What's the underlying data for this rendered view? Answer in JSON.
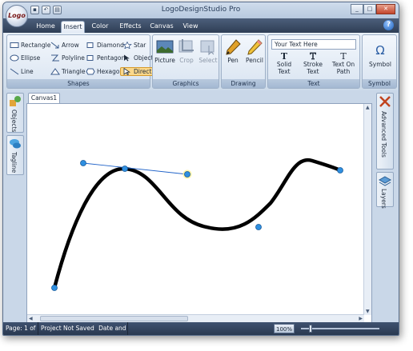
{
  "window": {
    "title": "LogoDesignStudio Pro",
    "logo_text": "Logo"
  },
  "quick_access": [
    "save-icon",
    "undo-icon",
    "print-icon"
  ],
  "tabs": [
    {
      "label": "Home",
      "active": false
    },
    {
      "label": "Insert",
      "active": true
    },
    {
      "label": "Color",
      "active": false
    },
    {
      "label": "Effects",
      "active": false
    },
    {
      "label": "Canvas",
      "active": false
    },
    {
      "label": "View",
      "active": false
    }
  ],
  "ribbon": {
    "shapes": {
      "caption": "Shapes",
      "items": [
        {
          "label": "Rectangle"
        },
        {
          "label": "Arrow"
        },
        {
          "label": "Diamond"
        },
        {
          "label": "Star"
        },
        {
          "label": "Ellipse"
        },
        {
          "label": "Polyline"
        },
        {
          "label": "Pentagon"
        },
        {
          "label": "Object"
        },
        {
          "label": "Line"
        },
        {
          "label": "Triangle"
        },
        {
          "label": "Hexagon"
        },
        {
          "label": "Direct",
          "selected": true
        }
      ]
    },
    "graphics": {
      "caption": "Graphics",
      "picture": "Picture",
      "crop": "Crop",
      "select": "Select"
    },
    "drawing": {
      "caption": "Drawing",
      "pen": "Pen",
      "pencil": "Pencil"
    },
    "text": {
      "caption": "Text",
      "input_value": "Your Text Here",
      "solid": [
        "Solid",
        "Text"
      ],
      "stroke": [
        "Stroke",
        "Text"
      ],
      "onpath": [
        "Text On",
        "Path"
      ]
    },
    "symbol": {
      "caption": "Symbol",
      "label": "Symbol",
      "glyph": "Ω"
    }
  },
  "left_panels": [
    "Objects",
    "Tagline"
  ],
  "right_panels": [
    "Advanced Tools",
    "Layers"
  ],
  "document_tab": "Canvas1",
  "status": {
    "page": "Page: 1 of 1",
    "project": "Project Not Saved",
    "datetime": "Date and Time",
    "zoom": "100%"
  },
  "colors": {
    "accent_selected": "#fbd88a",
    "curve": "#000000",
    "handle": "#2f8fe0",
    "handle_line": "#1f62c8",
    "tab_bar": "#2f3e55"
  }
}
